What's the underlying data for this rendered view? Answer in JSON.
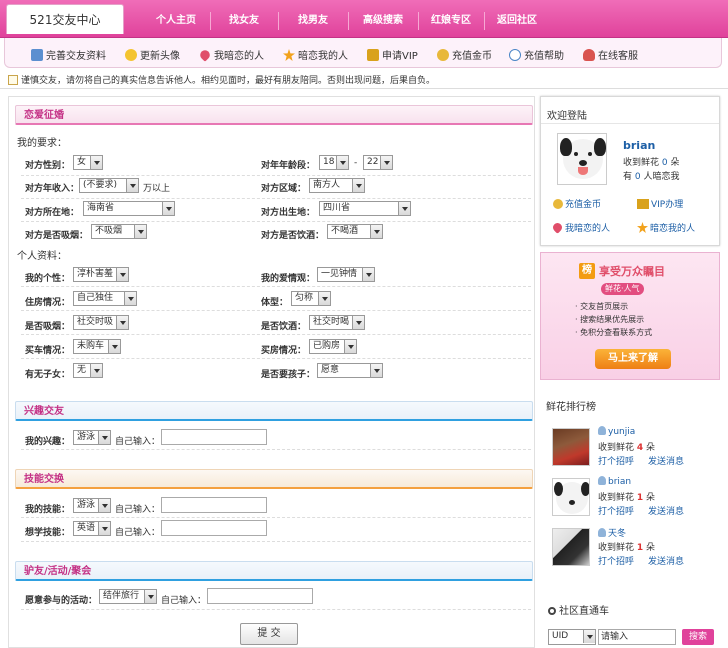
{
  "logo": {
    "text": "521交友中心"
  },
  "nav": [
    "个人主页",
    "找女友",
    "找男友",
    "高级搜索",
    "红娘专区",
    "返回社区"
  ],
  "subnav": [
    "完善交友资料",
    "更新头像",
    "我暗恋的人",
    "暗恋我的人",
    "申请VIP",
    "充值金币",
    "充值帮助",
    "在线客服"
  ],
  "notice": "谨慎交友，请勿将自己的真实信息告诉他人。相约见面时，最好有朋友陪同。否则出现问题，后果自负。",
  "sections": {
    "love": "恋爱征婚",
    "interest": "兴趣交友",
    "skill": "技能交换",
    "travel": "驴友/活动/聚会"
  },
  "requirements": {
    "title": "我的要求：",
    "gender_label": "对方性别：",
    "gender_value": "女",
    "age_label": "对年年龄段：",
    "age_from": "18",
    "age_sep": "-",
    "age_to": "22",
    "income_label": "对方年收入：",
    "income_value": "(不要求)",
    "income_suffix": "万以上",
    "region_label": "对方区域：",
    "region_value": "南方人",
    "location_label": "对方所在地：",
    "location_value": "海南省",
    "birthplace_label": "对方出生地：",
    "birthplace_value": "四川省",
    "smoke_label": "对方是否吸烟：",
    "smoke_value": "不吸烟",
    "drink_label": "对方是否饮酒：",
    "drink_value": "不喝酒"
  },
  "profile": {
    "title": "个人资料：",
    "personality_label": "我的个性：",
    "personality_value": "淳朴害羞",
    "loveview_label": "我的爱情观：",
    "loveview_value": "一见钟情",
    "housing_label": "住房情况：",
    "housing_value": "自己独住",
    "body_label": "体型：",
    "body_value": "匀称",
    "smoke_label": "是否吸烟：",
    "smoke_value": "社交时吸",
    "drink_label": "是否饮酒：",
    "drink_value": "社交时喝",
    "car_label": "买车情况：",
    "car_value": "未购车",
    "house_label": "买房情况：",
    "house_value": "已购房",
    "kids_label": "有无子女：",
    "kids_value": "无",
    "wantkids_label": "是否要孩子：",
    "wantkids_value": "愿意"
  },
  "interest": {
    "label": "我的兴趣：",
    "value": "游泳",
    "input_label": "自己输入："
  },
  "skill": {
    "my_label": "我的技能：",
    "my_value": "游泳",
    "my_input_label": "自己输入：",
    "learn_label": "想学技能：",
    "learn_value": "英语",
    "learn_input_label": "自己输入："
  },
  "travel": {
    "label": "愿意参与的活动：",
    "value": "结伴旅行",
    "input_label": "自己输入："
  },
  "submit": "提 交",
  "welcome": {
    "title": "欢迎登陆",
    "username": "brian",
    "flowers_prefix": "收到鲜花",
    "flowers_count": "0",
    "flowers_suffix": "朵",
    "crush_prefix": "有",
    "crush_count": "0",
    "crush_suffix": "人暗恋我",
    "links": [
      "充值金币",
      "VIP办理",
      "我暗恋的人",
      "暗恋我的人"
    ]
  },
  "promo": {
    "title": "享受万众瞩目",
    "badge": "榜",
    "tag": "鲜花·人气",
    "items": [
      "· 交友首页展示",
      "· 搜索结果优先展示",
      "· 免积分查看联系方式"
    ],
    "button": "马上来了解"
  },
  "ranking": {
    "title": "鲜花排行榜",
    "users": [
      {
        "name": "yunjia",
        "flowers_prefix": "收到鲜花",
        "flowers": "4",
        "flowers_suffix": "朵",
        "action1": "打个招呼",
        "action2": "发送消息"
      },
      {
        "name": "brian",
        "flowers_prefix": "收到鲜花",
        "flowers": "1",
        "flowers_suffix": "朵",
        "action1": "打个招呼",
        "action2": "发送消息"
      },
      {
        "name": "天冬",
        "flowers_prefix": "收到鲜花",
        "flowers": "1",
        "flowers_suffix": "朵",
        "action1": "打个招呼",
        "action2": "发送消息"
      }
    ]
  },
  "sidesearch": {
    "title": "社区直通车",
    "select_value": "UID",
    "placeholder": "请输入",
    "button": "搜索"
  },
  "colors": {
    "brand": "#e0429b",
    "link": "#1d5fa6",
    "accent_blue": "#2fa0e0",
    "accent_orange": "#f4a03e"
  }
}
